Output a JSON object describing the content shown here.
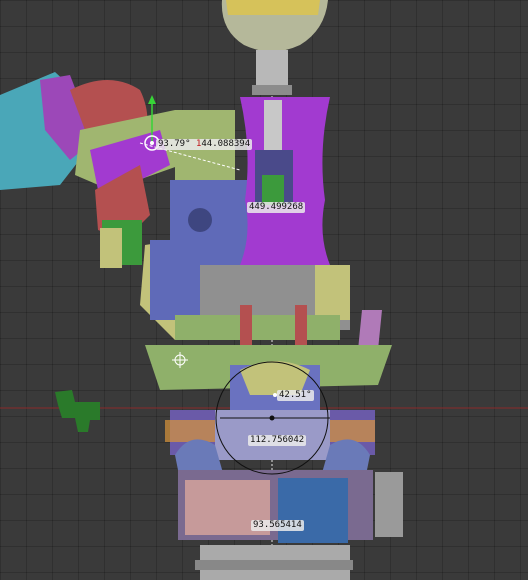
{
  "viewport": {
    "measurements": {
      "angle_top": "93.79°",
      "length_top_prefix": "1",
      "length_top_rest": "44.088394",
      "length_torso": "449.499268",
      "angle_center": "42.51°",
      "length_center": "112.756042",
      "length_bottom": "93.565414"
    },
    "colors": {
      "grid_background": "#3a3a3a",
      "purple_part": "#a23ad0",
      "green_part": "#8fb06a",
      "blue_part": "#5f6ab8",
      "yellow_part": "#c2c27a",
      "red_part": "#b45050",
      "teal_part": "#4da8b4",
      "gizmo_axis_green": "#37d437",
      "x_axis_red": "#8a2a2a"
    }
  }
}
